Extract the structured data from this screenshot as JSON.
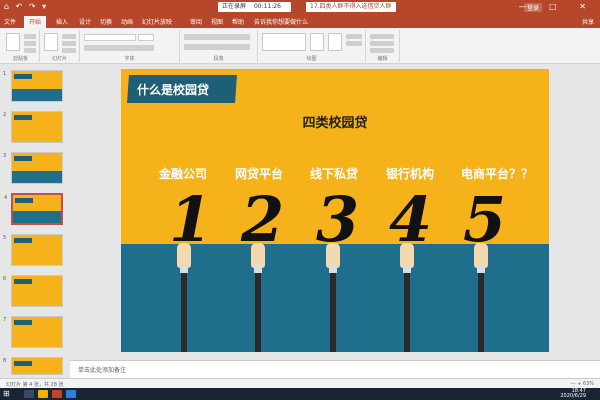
{
  "window": {
    "quick_access": "⌂ ↶ ↷ ▾",
    "recording_label": "正在录屏",
    "recording_time": "00:11:26",
    "document_title": "17.四类人群不得入选借贷人群",
    "login_label": "登录",
    "window_controls": "— □ ✕"
  },
  "menu": {
    "tabs": [
      "文件",
      "开始",
      "插入",
      "设计",
      "切换",
      "动画",
      "幻灯片放映",
      "审阅",
      "视图",
      "帮助",
      "告诉我你想要做什么"
    ],
    "active_tab_index": 1,
    "share_label": "共享"
  },
  "ribbon": {
    "groups": [
      "剪贴板",
      "幻灯片",
      "字体",
      "段落",
      "绘图",
      "编辑"
    ]
  },
  "thumbnails": [
    {
      "num": "1"
    },
    {
      "num": "2"
    },
    {
      "num": "3"
    },
    {
      "num": "4",
      "selected": true
    },
    {
      "num": "5"
    },
    {
      "num": "6"
    },
    {
      "num": "7"
    },
    {
      "num": "8"
    }
  ],
  "slide": {
    "header": "什么是校园贷",
    "subtitle": "四类校园贷",
    "categories": [
      "金融公司",
      "网贷平台",
      "线下私贷",
      "银行机构",
      "电商平台？？"
    ],
    "numbers": [
      "1",
      "2",
      "3",
      "4",
      "5"
    ],
    "colors": {
      "background": "#f6b21b",
      "band": "#1f6e8c",
      "header_box": "#1e5f76"
    }
  },
  "notes_placeholder": "单击此处添加备注",
  "status": {
    "left": "幻灯片 第 4 张，共 28 张",
    "right": "— + 63%"
  },
  "taskbar": {
    "start_icon": "⊞",
    "time": "18:47",
    "date": "2020/6/29"
  }
}
